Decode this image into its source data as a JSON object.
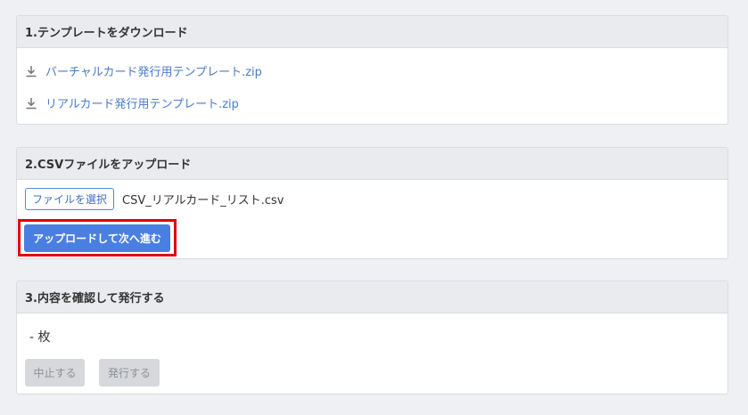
{
  "section1": {
    "title": "1.テンプレートをダウンロード",
    "links": [
      {
        "label": "バーチャルカード発行用テンプレート.zip",
        "icon": "download-icon"
      },
      {
        "label": "リアルカード発行用テンプレート.zip",
        "icon": "download-icon"
      }
    ]
  },
  "section2": {
    "title": "2.CSVファイルをアップロード",
    "file_button": "ファイルを選択",
    "file_name": "CSV_リアルカード_リスト.csv",
    "upload_button": "アップロードして次へ進む"
  },
  "section3": {
    "title": "3.内容を確認して発行する",
    "count": "- 枚",
    "cancel_button": "中止する",
    "issue_button": "発行する"
  },
  "colors": {
    "background": "#eef0f4",
    "link": "#4a7bc8",
    "primary": "#4a7fe2",
    "highlight": "#e00000",
    "disabled": "#d6d8db"
  }
}
